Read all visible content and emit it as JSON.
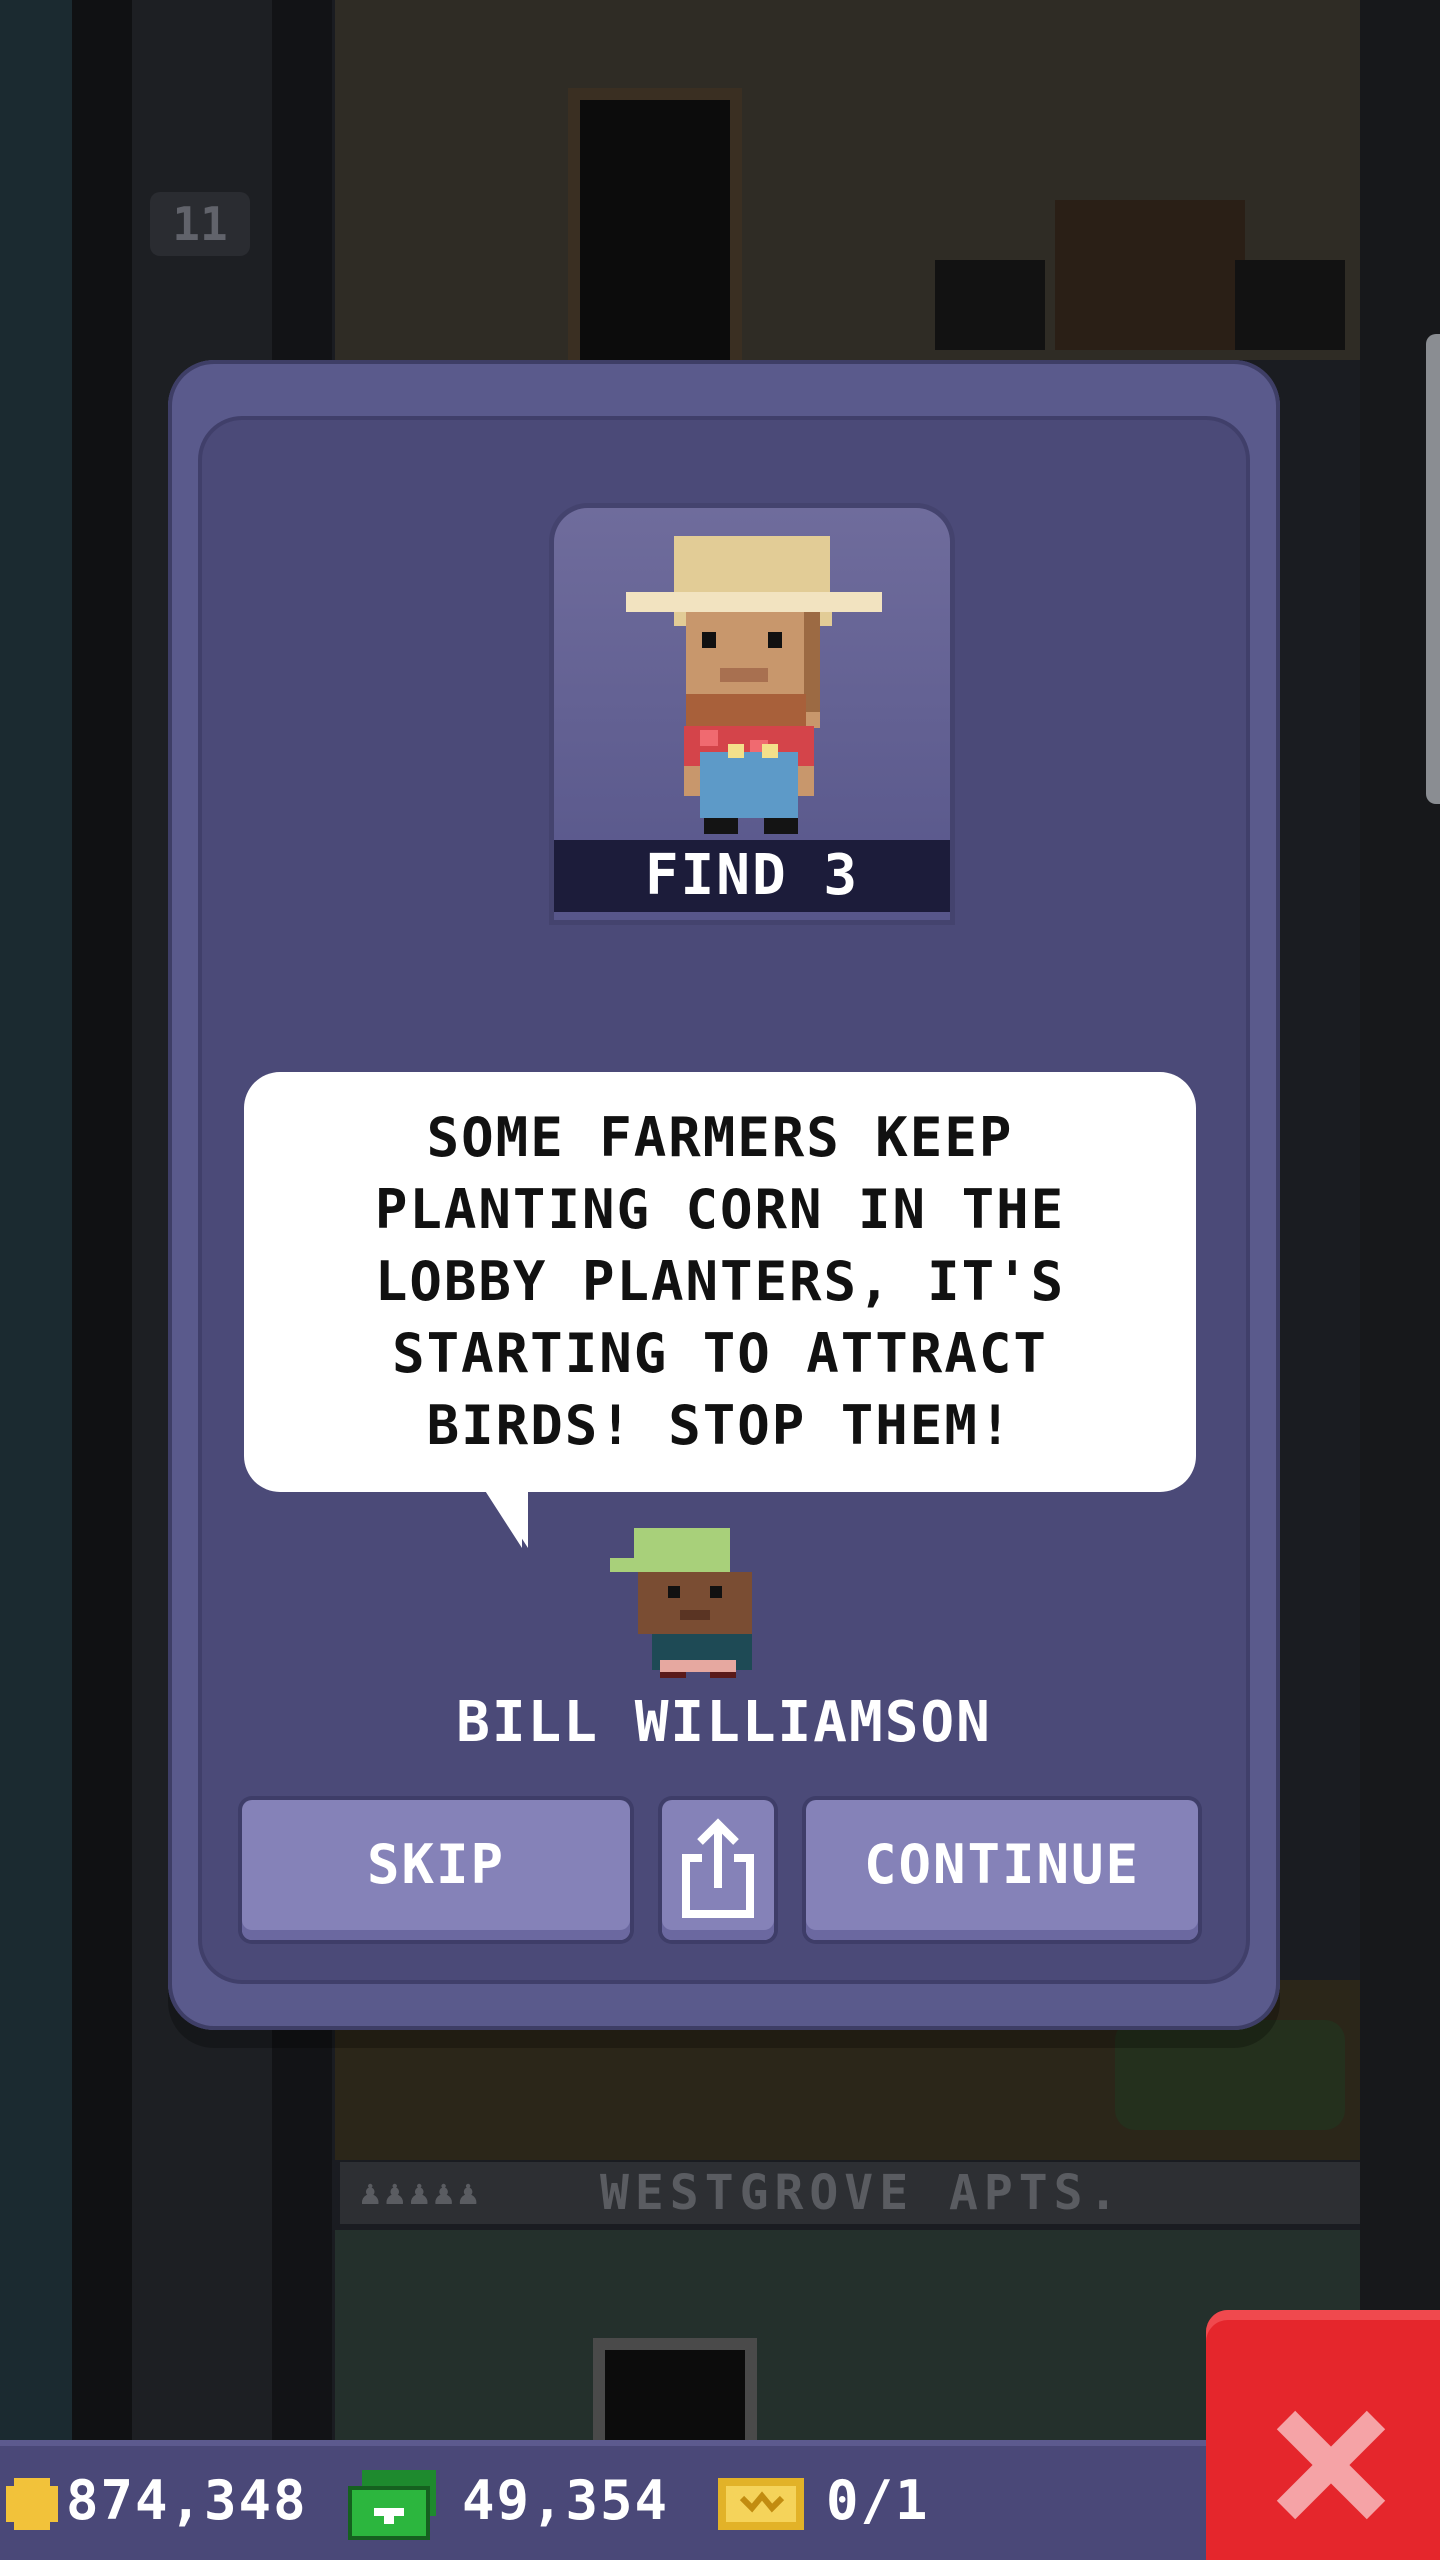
{
  "background": {
    "floor_number": "11",
    "tower_sign": {
      "name": "WESTGROVE APTS."
    }
  },
  "dialog": {
    "goal_label": "FIND 3",
    "speech_text": "SOME FARMERS KEEP PLANTING CORN IN THE LOBBY PLANTERS, IT'S STARTING TO ATTRACT BIRDS! STOP THEM!",
    "speaker_name": "BILL WILLIAMSON",
    "buttons": {
      "skip": "SKIP",
      "share_icon": "share-icon",
      "continue": "CONTINUE"
    }
  },
  "status_bar": {
    "coins": "874,348",
    "bux": "49,354",
    "tickets": "0/1",
    "coin_icon": "coin-icon",
    "bux_icon": "tower-bux-icon",
    "ticket_icon": "golden-ticket-icon"
  },
  "close_icon": "close-icon",
  "colors": {
    "dialog": "#5a5a8c",
    "dialog_inner": "#4b4a78",
    "button": "#8582b8",
    "close": "#e5262c",
    "status_bar": "#4a4878"
  }
}
